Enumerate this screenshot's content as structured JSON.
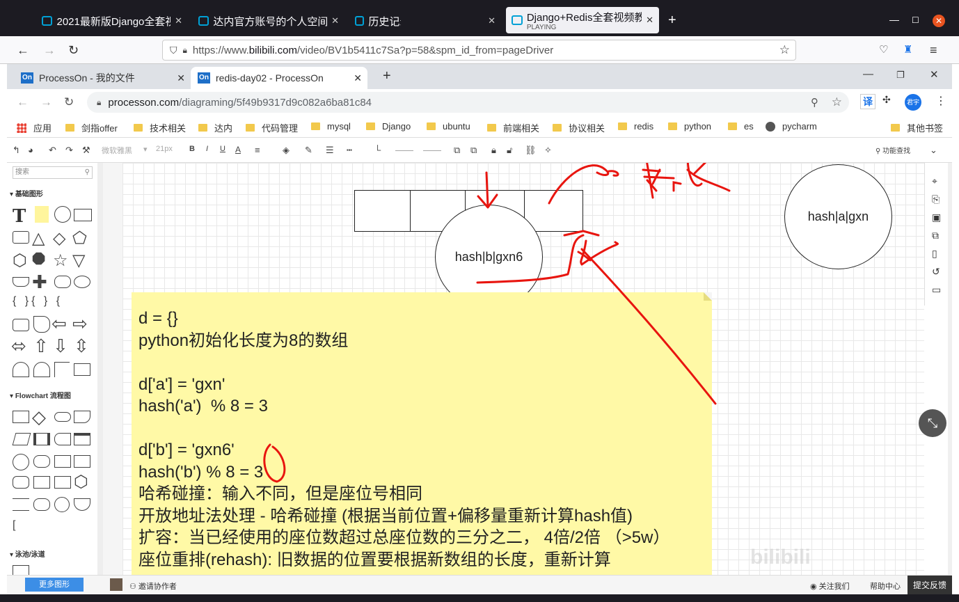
{
  "firefox": {
    "tabs": [
      {
        "title": "2021最新版Django全套视",
        "sub": ""
      },
      {
        "title": "达内官方账号的个人空间_",
        "sub": ""
      },
      {
        "title": "历史记录",
        "sub": ""
      },
      {
        "title": "Django+Redis全套视频教",
        "sub": "PLAYING"
      }
    ],
    "url_pre": "https://www.",
    "url_domain": "bilibili.com",
    "url_post": "/video/BV1b5411c7Sa?p=58&spm_id_from=pageDriver"
  },
  "chrome": {
    "tabs": [
      {
        "title": "ProcessOn - 我的文件",
        "icon": "On"
      },
      {
        "title": "redis-day02 - ProcessOn",
        "icon": "On"
      }
    ],
    "url_domain": "processon.com",
    "url_path": "/diagraming/5f49b9317d9c082a6ba81c84",
    "translate": "译",
    "avatar": "君宇",
    "bookmarks": [
      "应用",
      "剑指offer",
      "技术相关",
      "达内",
      "代码管理",
      "mysql",
      "Django",
      "ubuntu",
      "前端相关",
      "协议相关",
      "redis",
      "python",
      "es",
      "pycharm"
    ],
    "other_bookmarks": "其他书签"
  },
  "toolbar": {
    "font_name": "微软雅黑",
    "font_size": "21px",
    "find": "功能查找"
  },
  "left_panel": {
    "search_placeholder": "搜索",
    "sections": [
      "基础图形",
      "Flowchart 流程图",
      "泳池/泳道"
    ],
    "more_shapes": "更多图形"
  },
  "canvas": {
    "circle_b": "hash|b|gxn6",
    "circle_a": "hash|a|gxn",
    "note_text": "d = {}\npython初始化长度为8的数组\n\nd['a'] = 'gxn'\nhash('a')  % 8 = 3\n\nd['b'] = 'gxn6'\nhash('b') % 8 = 3\n哈希碰撞：输入不同，但是座位号相同\n开放地址法处理 - 哈希碰撞 (根据当前位置+偏移量重新计算hash值)\n扩容：当已经使用的座位数超过总座位数的三分之二， 4倍/2倍 （>5w）\n座位重排(rehash): 旧数据的位置要根据新数组的长度，重新计算"
  },
  "bottom": {
    "invite": "邀请协作者",
    "follow": "关注我们",
    "help": "帮助中心",
    "submit": "提交反馈"
  },
  "watermark": "bilibili"
}
